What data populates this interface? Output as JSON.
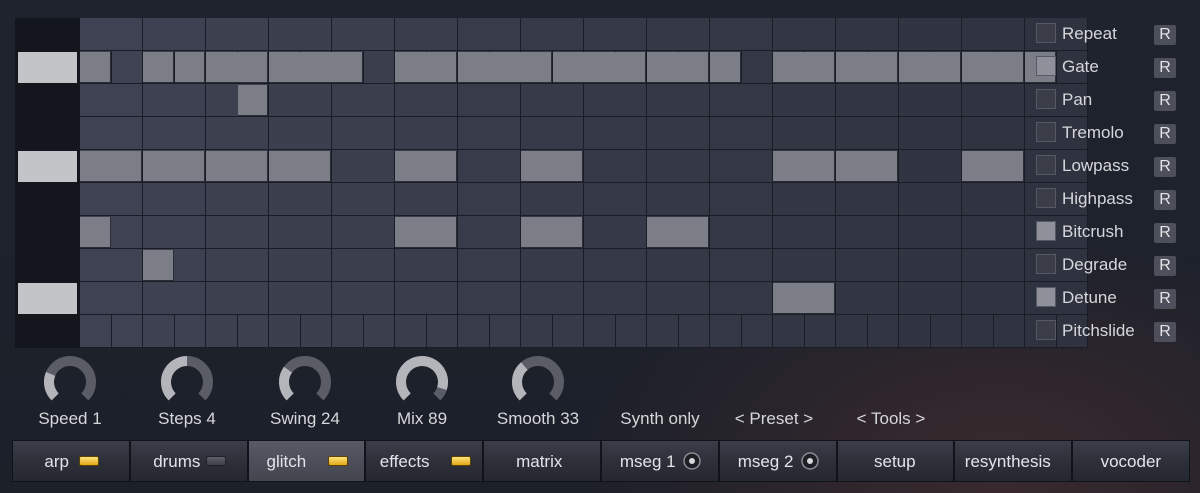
{
  "grid": {
    "rows": 10,
    "steps": 16,
    "row_markers": [
      1,
      4,
      8
    ],
    "row_subdivisions": [
      1,
      2,
      1,
      1,
      1,
      1,
      1,
      1,
      1,
      2
    ],
    "active": [
      [
        1,
        0,
        1
      ],
      [
        1,
        2,
        1
      ],
      [
        1,
        3,
        1
      ],
      [
        1,
        4,
        2
      ],
      [
        1,
        6,
        2
      ],
      [
        1,
        7,
        2
      ],
      [
        1,
        8,
        1
      ],
      [
        1,
        10,
        2
      ],
      [
        1,
        12,
        2
      ],
      [
        1,
        13,
        2
      ],
      [
        1,
        15,
        2
      ],
      [
        1,
        16,
        2
      ],
      [
        1,
        18,
        2
      ],
      [
        1,
        19,
        1
      ],
      [
        1,
        20,
        1
      ],
      [
        1,
        22,
        2
      ],
      [
        1,
        24,
        2
      ],
      [
        1,
        26,
        2
      ],
      [
        1,
        28,
        2
      ],
      [
        1,
        29,
        1
      ],
      [
        1,
        30,
        1
      ],
      [
        2,
        5,
        1
      ],
      [
        4,
        0,
        2
      ],
      [
        4,
        2,
        2
      ],
      [
        4,
        4,
        2
      ],
      [
        4,
        6,
        2
      ],
      [
        4,
        10,
        2
      ],
      [
        4,
        14,
        2
      ],
      [
        4,
        22,
        2
      ],
      [
        4,
        24,
        2
      ],
      [
        4,
        28,
        2
      ],
      [
        6,
        0,
        1
      ],
      [
        6,
        10,
        2
      ],
      [
        6,
        14,
        2
      ],
      [
        6,
        18,
        2
      ],
      [
        7,
        2,
        1
      ],
      [
        8,
        22,
        2
      ]
    ]
  },
  "effects": [
    {
      "label": "Repeat",
      "enabled": false,
      "reset": "R"
    },
    {
      "label": "Gate",
      "enabled": true,
      "reset": "R"
    },
    {
      "label": "Pan",
      "enabled": false,
      "reset": "R"
    },
    {
      "label": "Tremolo",
      "enabled": false,
      "reset": "R"
    },
    {
      "label": "Lowpass",
      "enabled": false,
      "reset": "R"
    },
    {
      "label": "Highpass",
      "enabled": false,
      "reset": "R"
    },
    {
      "label": "Bitcrush",
      "enabled": true,
      "reset": "R"
    },
    {
      "label": "Degrade",
      "enabled": false,
      "reset": "R"
    },
    {
      "label": "Detune",
      "enabled": true,
      "reset": "R"
    },
    {
      "label": "Pitchslide",
      "enabled": false,
      "reset": "R"
    }
  ],
  "knobs": [
    {
      "id": "speed",
      "label": "Speed 1",
      "value": 0.25
    },
    {
      "id": "steps",
      "label": "Steps 4",
      "value": 0.5
    },
    {
      "id": "swing",
      "label": "Swing 24",
      "value": 0.3
    },
    {
      "id": "mix",
      "label": "Mix 89",
      "value": 0.9
    },
    {
      "id": "smooth",
      "label": "Smooth 33",
      "value": 0.35
    }
  ],
  "buttons": {
    "synth_only": "Synth only",
    "preset": "< Preset >",
    "tools": "< Tools >"
  },
  "tabs": [
    {
      "label": "arp",
      "indicator": "led-on"
    },
    {
      "label": "drums",
      "indicator": "led-off"
    },
    {
      "label": "glitch",
      "indicator": "led-on",
      "active": true
    },
    {
      "label": "effects",
      "indicator": "led-on"
    },
    {
      "label": "matrix",
      "indicator": "none"
    },
    {
      "label": "mseg 1",
      "indicator": "ring"
    },
    {
      "label": "mseg 2",
      "indicator": "ring"
    },
    {
      "label": "setup",
      "indicator": "none"
    },
    {
      "label": "resynthesis",
      "indicator": "none"
    },
    {
      "label": "vocoder",
      "indicator": "none"
    }
  ],
  "colors": {
    "background": "#1c2029",
    "cell_off": "#2a2e3b",
    "cell_on": "#7b7d87",
    "led_on": "#f1c232",
    "knob_track": "#5a5c66",
    "knob_value": "#b4b5ba"
  }
}
